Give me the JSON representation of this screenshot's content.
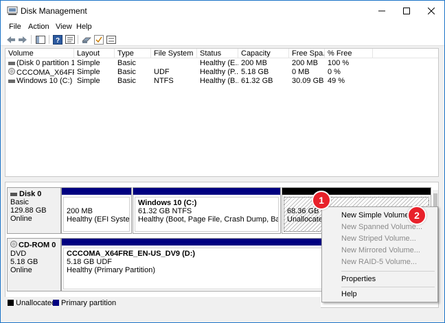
{
  "window": {
    "title": "Disk Management",
    "accent": "#1a73c7"
  },
  "menu": [
    "File",
    "Action",
    "View",
    "Help"
  ],
  "toolbar_icons": [
    "back-arrow-icon",
    "forward-arrow-icon",
    "console-tree-icon",
    "help-icon",
    "properties-icon",
    "disk-icon",
    "check-icon",
    "list-icon"
  ],
  "columns": [
    "Volume",
    "Layout",
    "Type",
    "File System",
    "Status",
    "Capacity",
    "Free Spa...",
    "% Free"
  ],
  "volumes": [
    {
      "icon": "drive-icon",
      "name": "(Disk 0 partition 1)",
      "layout": "Simple",
      "type": "Basic",
      "fs": "",
      "status": "Healthy (E...",
      "capacity": "200 MB",
      "free": "200 MB",
      "pct": "100 %"
    },
    {
      "icon": "cdrom-icon",
      "name": "CCCOMA_X64FRE...",
      "layout": "Simple",
      "type": "Basic",
      "fs": "UDF",
      "status": "Healthy (P...",
      "capacity": "5.18 GB",
      "free": "0 MB",
      "pct": "0 %"
    },
    {
      "icon": "drive-icon",
      "name": "Windows 10 (C:)",
      "layout": "Simple",
      "type": "Basic",
      "fs": "NTFS",
      "status": "Healthy (B...",
      "capacity": "61.32 GB",
      "free": "30.09 GB",
      "pct": "49 %"
    }
  ],
  "disks": [
    {
      "name": "Disk 0",
      "kind": "Basic",
      "size": "129.88 GB",
      "state": "Online",
      "partitions": [
        {
          "title": "",
          "line1": "200 MB",
          "line2": "Healthy (EFI System Pa"
        },
        {
          "title": "Windows 10  (C:)",
          "line1": "61.32 GB NTFS",
          "line2": "Healthy (Boot, Page File, Crash Dump, Basic Data I"
        },
        {
          "title": "",
          "line1": "68.36 GB",
          "line2": "Unallocated"
        }
      ]
    },
    {
      "name": "CD-ROM 0",
      "kind": "DVD",
      "size": "5.18 GB",
      "state": "Online",
      "partitions": [
        {
          "title": "CCCOMA_X64FRE_EN-US_DV9  (D:)",
          "line1": "5.18 GB UDF",
          "line2": "Healthy (Primary Partition)"
        }
      ]
    }
  ],
  "legend": [
    {
      "label": "Unallocated",
      "color": "#000000"
    },
    {
      "label": "Primary partition",
      "color": "#000080"
    }
  ],
  "context_menu": [
    {
      "label": "New Simple Volume...",
      "enabled": true
    },
    {
      "label": "New Spanned Volume...",
      "enabled": false
    },
    {
      "label": "New Striped Volume...",
      "enabled": false
    },
    {
      "label": "New Mirrored Volume...",
      "enabled": false
    },
    {
      "label": "New RAID-5 Volume...",
      "enabled": false
    },
    {
      "label": "Properties",
      "enabled": true
    },
    {
      "label": "Help",
      "enabled": true
    }
  ],
  "badges": [
    "1",
    "2"
  ],
  "colors": {
    "primary": "#000080",
    "unallocated": "#000000",
    "badge": "#e8212a"
  }
}
